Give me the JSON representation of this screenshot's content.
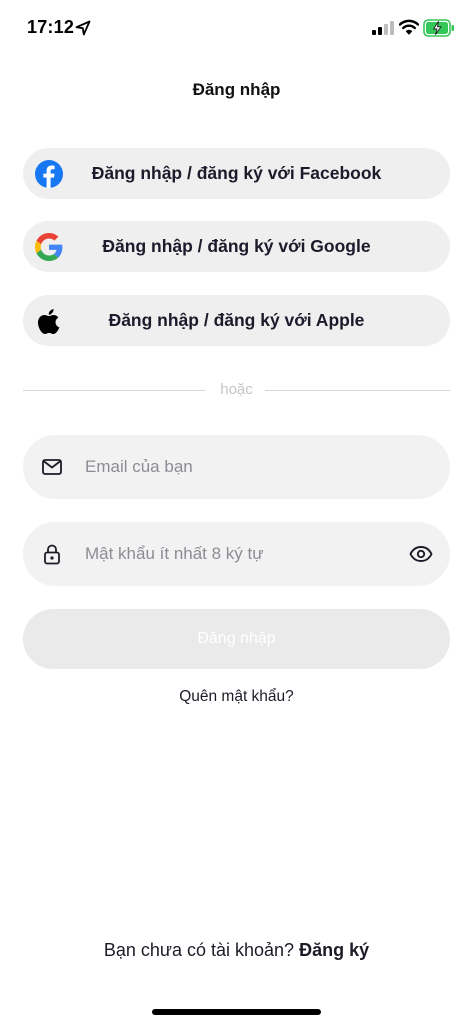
{
  "status_bar": {
    "time": "17:12",
    "icons": [
      "location-arrow-icon",
      "signal-icon",
      "wifi-icon",
      "battery-charging-icon"
    ],
    "battery_color": "#34c759"
  },
  "header": {
    "title": "Đăng nhập"
  },
  "social_buttons": [
    {
      "label": "Đăng nhập / đăng ký với Facebook",
      "icon": "facebook-icon",
      "color": "#1877f2"
    },
    {
      "label": "Đăng nhập / đăng ký với Google",
      "icon": "google-icon"
    },
    {
      "label": "Đăng nhập / đăng ký với Apple",
      "icon": "apple-icon"
    }
  ],
  "divider": {
    "text": "hoặc"
  },
  "email": {
    "value": "",
    "placeholder": "Email của bạn",
    "icon": "mail-icon"
  },
  "password": {
    "value": "",
    "placeholder": "Mật khẩu ít nhất 8 ký tự",
    "icon": "lock-icon",
    "toggle_icon": "eye-icon"
  },
  "submit": {
    "label": "Đăng nhập",
    "enabled": false
  },
  "forgot_password": {
    "label": "Quên mật khẩu?"
  },
  "footer": {
    "prompt": "Bạn chưa có tài khoản?",
    "link": "Đăng ký"
  }
}
